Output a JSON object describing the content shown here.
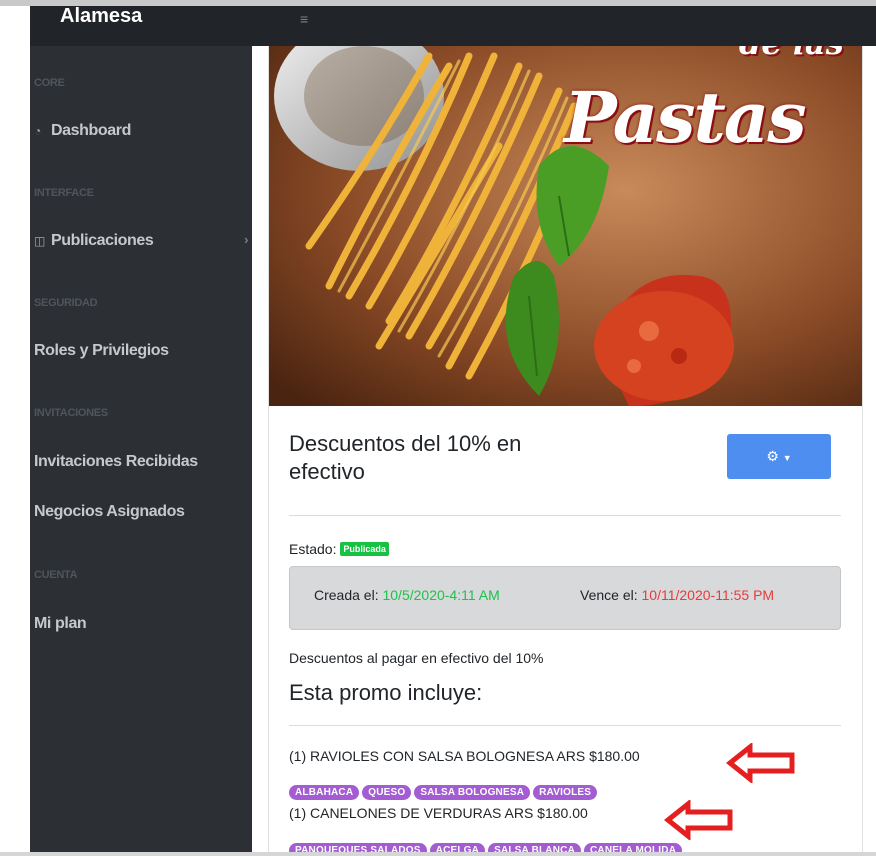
{
  "topbar": {
    "brand": "Alamesa",
    "toggle_icon": "hamburger-icon"
  },
  "sidebar": {
    "sections": [
      {
        "heading": "CORE",
        "items": [
          {
            "label": "Dashboard",
            "icon": "dashboard-icon"
          }
        ]
      },
      {
        "heading": "INTERFACE",
        "items": [
          {
            "label": "Publicaciones",
            "icon": "columns-icon",
            "has_chevron": true
          }
        ]
      },
      {
        "heading": "SEGURIDAD",
        "items": [
          {
            "label": "Roles y Privilegios"
          }
        ]
      },
      {
        "heading": "INVITACIONES",
        "items": [
          {
            "label": "Invitaciones Recibidas"
          },
          {
            "label": "Negocios Asignados"
          }
        ]
      },
      {
        "heading": "CUENTA",
        "items": [
          {
            "label": "Mi plan"
          }
        ]
      }
    ]
  },
  "hero": {
    "title_small": "de las",
    "title_big": "Pastas"
  },
  "promo": {
    "title": "Descuentos del 10% en efectivo",
    "actions_icon": "gears-icon",
    "estado_label": "Estado:",
    "estado_badge": "Publicada",
    "created_label": "Creada el:",
    "created_value": "10/5/2020-4:11 AM",
    "expires_label": "Vence el:",
    "expires_value": "10/11/2020-11:55 PM",
    "description": "Descuentos al pagar en efectivo del 10%",
    "includes_heading": "Esta promo incluye:",
    "items": [
      {
        "text": "(1) RAVIOLES CON SALSA BOLOGNESA ARS $180.00",
        "tags": [
          "ALBAHACA",
          "QUESO",
          "SALSA BOLOGNESA",
          "RAVIOLES"
        ]
      },
      {
        "text": "(1) CANELONES DE VERDURAS ARS $180.00",
        "tags": [
          "PANQUEQUES SALADOS",
          "ACELGA",
          "SALSA BLANCA",
          "CANELA MOLIDA"
        ]
      }
    ]
  },
  "colors": {
    "accent": "#4e8ef0",
    "published": "#17c242",
    "created": "#1ec24a",
    "expires": "#ea3a3a",
    "tag": "#a45cd3",
    "annotation_arrow": "#e51f1f"
  }
}
